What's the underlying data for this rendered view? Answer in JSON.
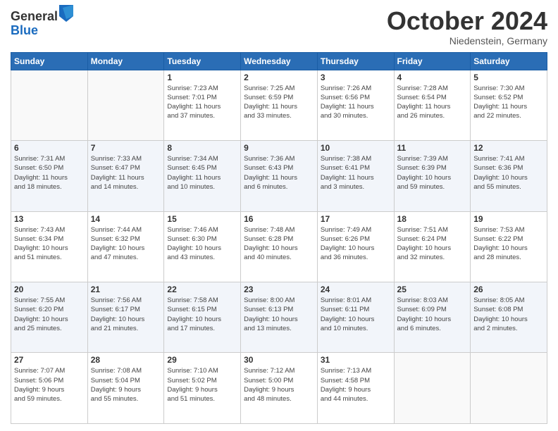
{
  "logo": {
    "general": "General",
    "blue": "Blue"
  },
  "title": "October 2024",
  "location": "Niedenstein, Germany",
  "days_of_week": [
    "Sunday",
    "Monday",
    "Tuesday",
    "Wednesday",
    "Thursday",
    "Friday",
    "Saturday"
  ],
  "weeks": [
    [
      {
        "day": "",
        "info": ""
      },
      {
        "day": "",
        "info": ""
      },
      {
        "day": "1",
        "info": "Sunrise: 7:23 AM\nSunset: 7:01 PM\nDaylight: 11 hours\nand 37 minutes."
      },
      {
        "day": "2",
        "info": "Sunrise: 7:25 AM\nSunset: 6:59 PM\nDaylight: 11 hours\nand 33 minutes."
      },
      {
        "day": "3",
        "info": "Sunrise: 7:26 AM\nSunset: 6:56 PM\nDaylight: 11 hours\nand 30 minutes."
      },
      {
        "day": "4",
        "info": "Sunrise: 7:28 AM\nSunset: 6:54 PM\nDaylight: 11 hours\nand 26 minutes."
      },
      {
        "day": "5",
        "info": "Sunrise: 7:30 AM\nSunset: 6:52 PM\nDaylight: 11 hours\nand 22 minutes."
      }
    ],
    [
      {
        "day": "6",
        "info": "Sunrise: 7:31 AM\nSunset: 6:50 PM\nDaylight: 11 hours\nand 18 minutes."
      },
      {
        "day": "7",
        "info": "Sunrise: 7:33 AM\nSunset: 6:47 PM\nDaylight: 11 hours\nand 14 minutes."
      },
      {
        "day": "8",
        "info": "Sunrise: 7:34 AM\nSunset: 6:45 PM\nDaylight: 11 hours\nand 10 minutes."
      },
      {
        "day": "9",
        "info": "Sunrise: 7:36 AM\nSunset: 6:43 PM\nDaylight: 11 hours\nand 6 minutes."
      },
      {
        "day": "10",
        "info": "Sunrise: 7:38 AM\nSunset: 6:41 PM\nDaylight: 11 hours\nand 3 minutes."
      },
      {
        "day": "11",
        "info": "Sunrise: 7:39 AM\nSunset: 6:39 PM\nDaylight: 10 hours\nand 59 minutes."
      },
      {
        "day": "12",
        "info": "Sunrise: 7:41 AM\nSunset: 6:36 PM\nDaylight: 10 hours\nand 55 minutes."
      }
    ],
    [
      {
        "day": "13",
        "info": "Sunrise: 7:43 AM\nSunset: 6:34 PM\nDaylight: 10 hours\nand 51 minutes."
      },
      {
        "day": "14",
        "info": "Sunrise: 7:44 AM\nSunset: 6:32 PM\nDaylight: 10 hours\nand 47 minutes."
      },
      {
        "day": "15",
        "info": "Sunrise: 7:46 AM\nSunset: 6:30 PM\nDaylight: 10 hours\nand 43 minutes."
      },
      {
        "day": "16",
        "info": "Sunrise: 7:48 AM\nSunset: 6:28 PM\nDaylight: 10 hours\nand 40 minutes."
      },
      {
        "day": "17",
        "info": "Sunrise: 7:49 AM\nSunset: 6:26 PM\nDaylight: 10 hours\nand 36 minutes."
      },
      {
        "day": "18",
        "info": "Sunrise: 7:51 AM\nSunset: 6:24 PM\nDaylight: 10 hours\nand 32 minutes."
      },
      {
        "day": "19",
        "info": "Sunrise: 7:53 AM\nSunset: 6:22 PM\nDaylight: 10 hours\nand 28 minutes."
      }
    ],
    [
      {
        "day": "20",
        "info": "Sunrise: 7:55 AM\nSunset: 6:20 PM\nDaylight: 10 hours\nand 25 minutes."
      },
      {
        "day": "21",
        "info": "Sunrise: 7:56 AM\nSunset: 6:17 PM\nDaylight: 10 hours\nand 21 minutes."
      },
      {
        "day": "22",
        "info": "Sunrise: 7:58 AM\nSunset: 6:15 PM\nDaylight: 10 hours\nand 17 minutes."
      },
      {
        "day": "23",
        "info": "Sunrise: 8:00 AM\nSunset: 6:13 PM\nDaylight: 10 hours\nand 13 minutes."
      },
      {
        "day": "24",
        "info": "Sunrise: 8:01 AM\nSunset: 6:11 PM\nDaylight: 10 hours\nand 10 minutes."
      },
      {
        "day": "25",
        "info": "Sunrise: 8:03 AM\nSunset: 6:09 PM\nDaylight: 10 hours\nand 6 minutes."
      },
      {
        "day": "26",
        "info": "Sunrise: 8:05 AM\nSunset: 6:08 PM\nDaylight: 10 hours\nand 2 minutes."
      }
    ],
    [
      {
        "day": "27",
        "info": "Sunrise: 7:07 AM\nSunset: 5:06 PM\nDaylight: 9 hours\nand 59 minutes."
      },
      {
        "day": "28",
        "info": "Sunrise: 7:08 AM\nSunset: 5:04 PM\nDaylight: 9 hours\nand 55 minutes."
      },
      {
        "day": "29",
        "info": "Sunrise: 7:10 AM\nSunset: 5:02 PM\nDaylight: 9 hours\nand 51 minutes."
      },
      {
        "day": "30",
        "info": "Sunrise: 7:12 AM\nSunset: 5:00 PM\nDaylight: 9 hours\nand 48 minutes."
      },
      {
        "day": "31",
        "info": "Sunrise: 7:13 AM\nSunset: 4:58 PM\nDaylight: 9 hours\nand 44 minutes."
      },
      {
        "day": "",
        "info": ""
      },
      {
        "day": "",
        "info": ""
      }
    ]
  ]
}
